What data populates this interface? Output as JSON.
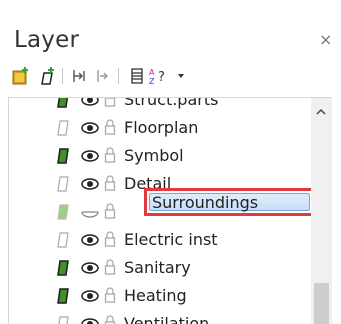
{
  "panel": {
    "title": "Layer",
    "close_symbol": "×"
  },
  "toolbar": {
    "buttons": [
      {
        "name": "new-folder-icon"
      },
      {
        "name": "new-layer-icon"
      },
      {
        "name": "indent-icon"
      },
      {
        "name": "outdent-icon"
      },
      {
        "name": "stack-icon"
      },
      {
        "name": "sort-az-help-icon"
      },
      {
        "name": "dropdown-arrow-icon"
      }
    ]
  },
  "layers": [
    {
      "label": "Struct.parts",
      "indicator": "filled",
      "visible": true
    },
    {
      "label": "Floorplan",
      "indicator": "empty",
      "visible": true
    },
    {
      "label": "Symbol",
      "indicator": "filled",
      "visible": true
    },
    {
      "label": "Detail",
      "indicator": "empty",
      "visible": true
    },
    {
      "label": "Surroundings",
      "indicator": "light",
      "visible": false,
      "selected": true
    },
    {
      "label": "Electric inst",
      "indicator": "empty",
      "visible": true
    },
    {
      "label": "Sanitary",
      "indicator": "filled",
      "visible": true
    },
    {
      "label": "Heating",
      "indicator": "filled",
      "visible": true
    },
    {
      "label": "Ventilation",
      "indicator": "empty",
      "visible": true
    }
  ],
  "colors": {
    "accent_filled": "#3f8f2a",
    "selection_border": "#e03a3e"
  }
}
